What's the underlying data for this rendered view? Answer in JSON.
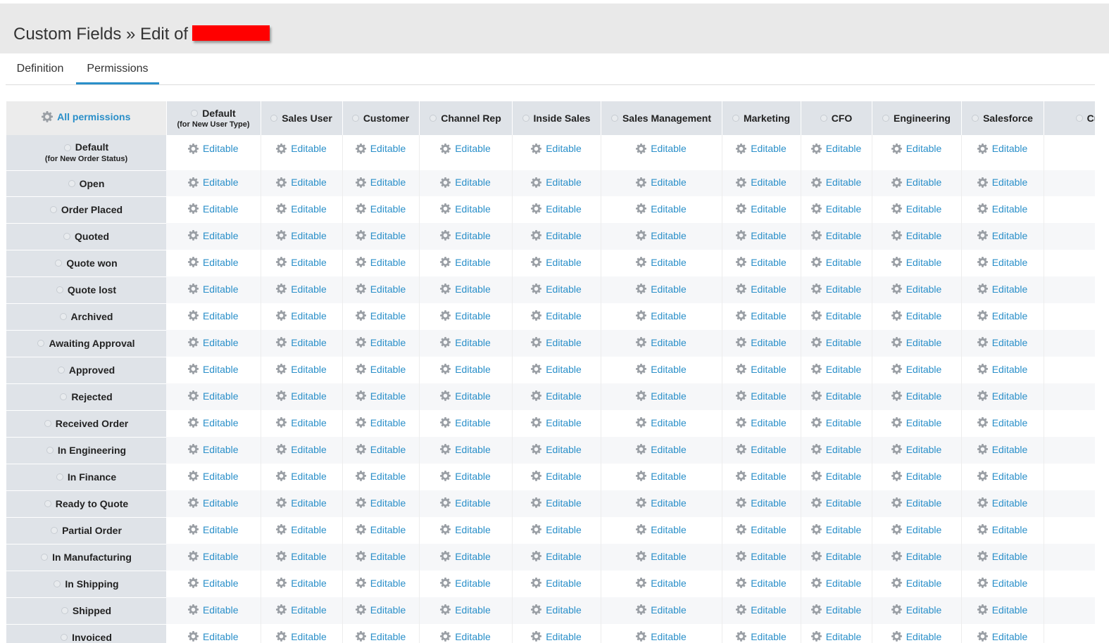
{
  "header": {
    "title": "Custom Fields » Edit of"
  },
  "tabs": [
    {
      "label": "Definition",
      "active": false
    },
    {
      "label": "Permissions",
      "active": true
    }
  ],
  "grid": {
    "all_permissions_label": "All permissions",
    "cell_value": "Editable",
    "columns": [
      {
        "label": "Default",
        "sub": "(for New User Type)"
      },
      {
        "label": "Sales User",
        "sub": ""
      },
      {
        "label": "Customer",
        "sub": ""
      },
      {
        "label": "Channel Rep",
        "sub": ""
      },
      {
        "label": "Inside Sales",
        "sub": ""
      },
      {
        "label": "Sales Management",
        "sub": ""
      },
      {
        "label": "Marketing",
        "sub": ""
      },
      {
        "label": "CFO",
        "sub": ""
      },
      {
        "label": "Engineering",
        "sub": ""
      },
      {
        "label": "Salesforce",
        "sub": ""
      },
      {
        "label": "Custo",
        "sub": ""
      }
    ],
    "rows": [
      {
        "label": "Default",
        "sub": "(for New Order Status)"
      },
      {
        "label": "Open",
        "sub": ""
      },
      {
        "label": "Order Placed",
        "sub": ""
      },
      {
        "label": "Quoted",
        "sub": ""
      },
      {
        "label": "Quote won",
        "sub": ""
      },
      {
        "label": "Quote lost",
        "sub": ""
      },
      {
        "label": "Archived",
        "sub": ""
      },
      {
        "label": "Awaiting Approval",
        "sub": ""
      },
      {
        "label": "Approved",
        "sub": ""
      },
      {
        "label": "Rejected",
        "sub": ""
      },
      {
        "label": "Received Order",
        "sub": ""
      },
      {
        "label": "In Engineering",
        "sub": ""
      },
      {
        "label": "In Finance",
        "sub": ""
      },
      {
        "label": "Ready to Quote",
        "sub": ""
      },
      {
        "label": "Partial Order",
        "sub": ""
      },
      {
        "label": "In Manufacturing",
        "sub": ""
      },
      {
        "label": "In Shipping",
        "sub": ""
      },
      {
        "label": "Shipped",
        "sub": ""
      },
      {
        "label": "Invoiced",
        "sub": ""
      }
    ]
  },
  "colors": {
    "accent": "#2a8fc9",
    "redaction": "#ff0000"
  },
  "icons": {
    "cell_icon": "gear-icon",
    "header_icon": "dot-icon"
  }
}
